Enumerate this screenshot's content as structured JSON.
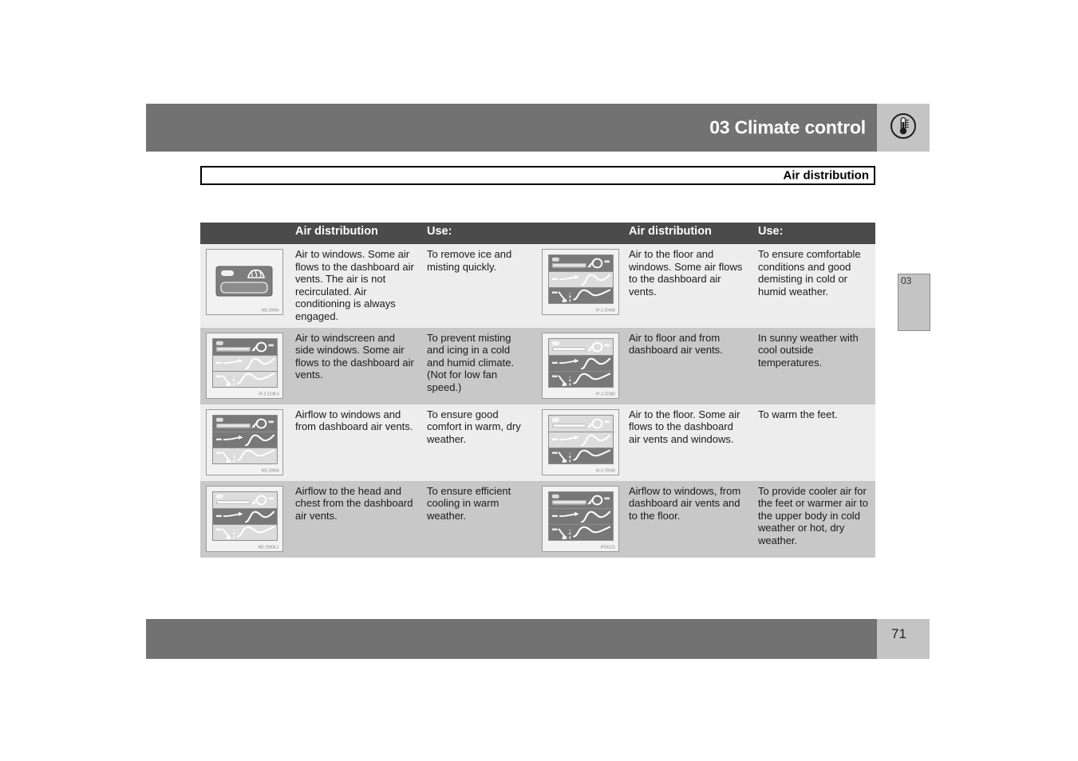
{
  "header": {
    "title": "03 Climate control",
    "icon": "thermometer-icon"
  },
  "section": {
    "label": "Air distribution"
  },
  "chapter_tab": {
    "label": "03"
  },
  "footer": {
    "page_number": "71"
  },
  "table": {
    "headers": {
      "img_left": "",
      "distribution_left": "Air distribution",
      "use_left": "Use:",
      "img_right": "",
      "distribution_right": "Air distribution",
      "use_right": "Use:"
    },
    "rows": [
      {
        "left": {
          "image": {
            "type": "defrost-button",
            "code": "MS 2049x",
            "panels": {
              "top": "lit",
              "mid": "none",
              "bot": "none"
            }
          },
          "distribution": "Air to windows. Some air flows to the dashboard air vents. The air is not recirculated. Air conditioning is always engaged.",
          "use": "To remove ice and misting quickly."
        },
        "right": {
          "image": {
            "type": "three-panel",
            "code": "IP-3 20408",
            "panels": {
              "top": "lit",
              "mid": "dim",
              "bot": "lit"
            }
          },
          "distribution": "Air to the floor and windows. Some air flows to the dashboard air vents.",
          "use": "To ensure comfortable conditions and good demisting in cold or humid weather."
        }
      },
      {
        "left": {
          "image": {
            "type": "three-panel",
            "code": "IP-3 2238-0",
            "panels": {
              "top": "lit",
              "mid": "dim",
              "bot": "dim"
            }
          },
          "distribution": "Air to windscreen and side windows. Some air flows to the dashboard air vents.",
          "use": "To prevent misting and icing in a cold and humid climate. (Not for low fan speed.)"
        },
        "right": {
          "image": {
            "type": "three-panel",
            "code": "IP-3 22380",
            "panels": {
              "top": "dim",
              "mid": "lit",
              "bot": "lit"
            }
          },
          "distribution": "Air to floor and from dashboard air vents.",
          "use": "In sunny weather with cool outside temperatures."
        }
      },
      {
        "left": {
          "image": {
            "type": "three-panel",
            "code": "MS 20904",
            "panels": {
              "top": "lit",
              "mid": "lit",
              "bot": "dim"
            }
          },
          "distribution": "Airflow to windows and from dashboard air vents.",
          "use": "To ensure good comfort in warm, dry weather."
        },
        "right": {
          "image": {
            "type": "three-panel",
            "code": "IK-3 76548",
            "panels": {
              "top": "dim",
              "mid": "dim",
              "bot": "lit"
            }
          },
          "distribution": "Air to the floor. Some air flows to the dashboard air vents and windows.",
          "use": "To warm the feet."
        }
      },
      {
        "left": {
          "image": {
            "type": "three-panel",
            "code": "MS 20904-1",
            "panels": {
              "top": "dim",
              "mid": "lit",
              "bot": "dim"
            }
          },
          "distribution": "Airflow to the head and chest from the dashboard air vents.",
          "use": "To ensure efficient cooling in warm weather."
        },
        "right": {
          "image": {
            "type": "three-panel",
            "code": "IP54215",
            "panels": {
              "top": "lit",
              "mid": "lit",
              "bot": "lit"
            }
          },
          "distribution": "Airflow to windows, from dashboard air vents and to the floor.",
          "use": "To provide cooler air for the feet or warmer air to the upper body in cold weather or hot, dry weather."
        }
      }
    ]
  },
  "colors": {
    "band_gray": "#727272",
    "tab_gray": "#c4c4c4",
    "header_row": "#4b4b4b",
    "row_light": "#ededed",
    "row_dark": "#c8c8c8"
  }
}
